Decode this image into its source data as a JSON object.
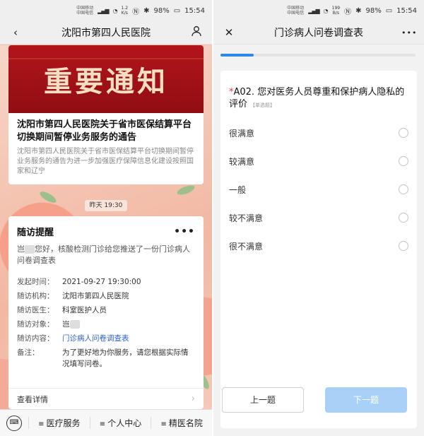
{
  "left": {
    "status": {
      "carrier1": "中国移动",
      "carrier2": "中国电信",
      "speed_num": "1.2",
      "speed_unit": "K/s",
      "battery": "98%",
      "time": "15:54"
    },
    "nav": {
      "title": "沈阳市第四人民医院"
    },
    "notice": {
      "banner_text": "重要通知",
      "title": "沈阳市第四人民医院关于省市医保结算平台切换期间暂停业务服务的通告",
      "desc": "沈阳市第四人民医院关于省市医保结算平台切换期间暂停业务服务的通告为进一步加强医疗保障信息化建设按照国家和辽宁"
    },
    "timestamp": "昨天 19:30",
    "followup": {
      "title": "随访提醒",
      "more": "•••",
      "msg_prefix": "岂",
      "msg_rest": "您好，核酸检测门诊给您推送了一份门诊病人问卷调查表",
      "rows": [
        {
          "k": "发起时间：",
          "v": "2021-09-27 19:30:00"
        },
        {
          "k": "随访机构：",
          "v": "沈阳市第四人民医院"
        },
        {
          "k": "随访医生：",
          "v": "科室医护人员"
        },
        {
          "k": "随访对象：",
          "v": "岂"
        },
        {
          "k": "随访内容：",
          "v": "门诊病人问卷调查表"
        },
        {
          "k": "备注：",
          "v": "为了更好地为你服务，请您根据实际情况填写问卷。"
        }
      ],
      "details_label": "查看详情"
    },
    "bottom": {
      "keyboard": "⌨",
      "menu": [
        "医疗服务",
        "个人中心",
        "精医名院"
      ]
    }
  },
  "right": {
    "status": {
      "carrier1": "中国移动",
      "carrier2": "中国电信",
      "speed_num": "199",
      "speed_unit": "B/s",
      "battery": "98%",
      "time": "15:54"
    },
    "nav": {
      "title": "门诊病人问卷调查表",
      "more": "•••"
    },
    "progress": 0.17,
    "question": {
      "star": "*",
      "text": "A02. 您对医务人员尊重和保护病人隐私的评价",
      "tag": "【单选题】",
      "options": [
        "很满意",
        "较满意",
        "一般",
        "较不满意",
        "很不满意"
      ]
    },
    "buttons": {
      "prev": "上一题",
      "next": "下一题"
    },
    "colors": {
      "accent": "#2f86e6",
      "next_disabled": "#a9d1f7",
      "required": "#e23b3b",
      "link": "#2b5fd9"
    }
  }
}
